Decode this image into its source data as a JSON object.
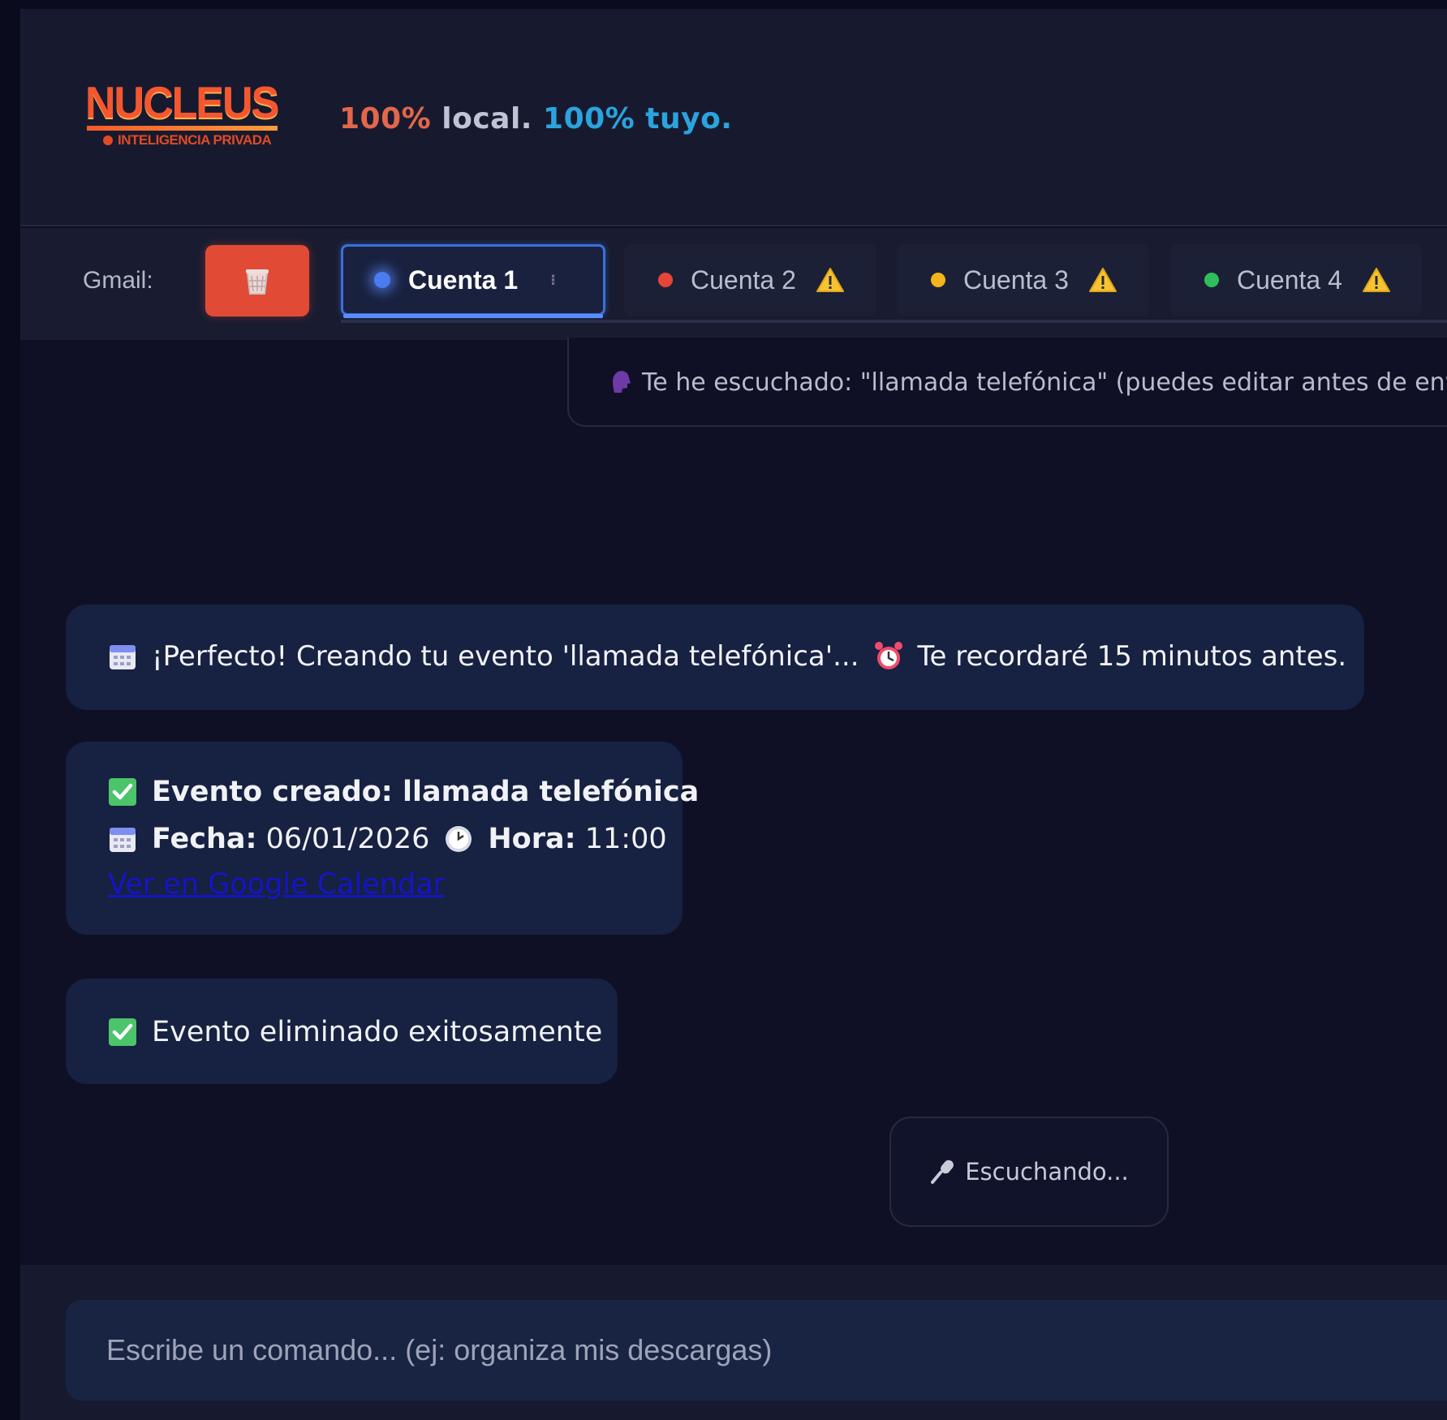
{
  "header": {
    "logo": {
      "title": "NUCLEUS",
      "subtitle": "INTELIGENCIA PRIVADA"
    },
    "tagline": {
      "part1": "100% ",
      "part2": "local. ",
      "part3": "100% tuyo."
    }
  },
  "gmail_bar": {
    "label": "Gmail:",
    "trash_icon": "trash-icon",
    "tabs": [
      {
        "label": "Cuenta 1",
        "dot_color": "#4a7cf0",
        "active": true,
        "warning": false
      },
      {
        "label": "Cuenta 2",
        "dot_color": "#e5453a",
        "active": false,
        "warning": true
      },
      {
        "label": "Cuenta 3",
        "dot_color": "#f3b41c",
        "active": false,
        "warning": true
      },
      {
        "label": "Cuenta 4",
        "dot_color": "#2fbf5a",
        "active": false,
        "warning": true
      }
    ]
  },
  "transcript": {
    "icon": "speaking-head-icon",
    "text": "Te he escuchado: \"llamada telefónica\" (puedes editar antes de enviar"
  },
  "messages": {
    "m1": {
      "icon": "calendar-icon",
      "text_a": "¡Perfecto! Creando tu evento 'llamada telefónica'...",
      "icon2": "alarm-clock-icon",
      "text_b": "Te recordaré 15 minutos antes."
    },
    "m2": {
      "icon": "check-box-icon",
      "title": "Evento creado: llamada telefónica",
      "date_label": "Fecha:",
      "date_value": "06/01/2026",
      "time_label": "Hora:",
      "time_value": "11:00",
      "link": "Ver en Google Calendar"
    },
    "m3": {
      "icon": "check-box-icon",
      "text": "Evento eliminado exitosamente"
    }
  },
  "listening": {
    "icon": "microphone-icon",
    "text": "Escuchando..."
  },
  "input": {
    "placeholder": "Escribe un comando... (ej: organiza mis descargas)",
    "value": ""
  },
  "colors": {
    "background": "#0f1025",
    "bubble": "#172141",
    "accent": "#3c6fd9",
    "trash": "#e14b35"
  }
}
